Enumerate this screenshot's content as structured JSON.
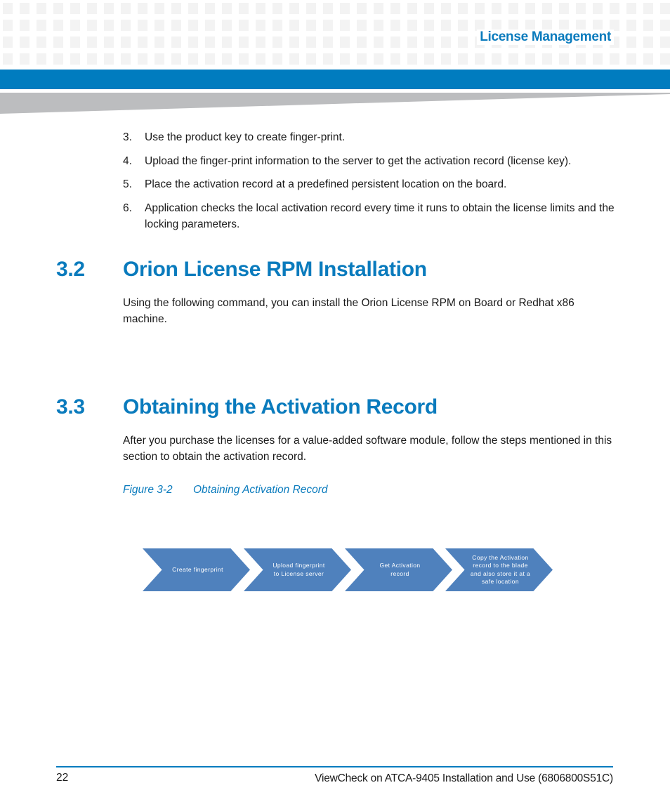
{
  "header": {
    "section_title": "License Management",
    "accent_color": "#007cbf"
  },
  "steps": [
    {
      "num": "3.",
      "text": "Use the product key to create finger-print."
    },
    {
      "num": "4.",
      "text": "Upload the finger-print information to the server to get the activation record (license key)."
    },
    {
      "num": "5.",
      "text": "Place the activation record at a predefined persistent location on the board."
    },
    {
      "num": "6.",
      "text": "Application checks the local activation record every time it runs to obtain the license limits and the locking parameters."
    }
  ],
  "sections": [
    {
      "number": "3.2",
      "title": "Orion License RPM Installation",
      "body": "Using the following command, you can install the Orion License RPM on Board or Redhat x86 machine."
    },
    {
      "number": "3.3",
      "title": "Obtaining the Activation Record",
      "body": "After you purchase the licenses for a value-added software module, follow the steps mentioned in this section to obtain the activation record."
    }
  ],
  "figure": {
    "label": "Figure 3-2",
    "title": "Obtaining Activation Record",
    "flow_color": "#4f81bd",
    "steps": [
      "Create fingerprint",
      "Upload fingerprint\nto License server",
      "Get Activation\nrecord",
      "Copy the Activation\nrecord to the blade\nand also store it at a\nsafe location"
    ]
  },
  "footer": {
    "page_number": "22",
    "document_title": "ViewCheck on ATCA-9405 Installation and Use (6806800S51C)"
  }
}
